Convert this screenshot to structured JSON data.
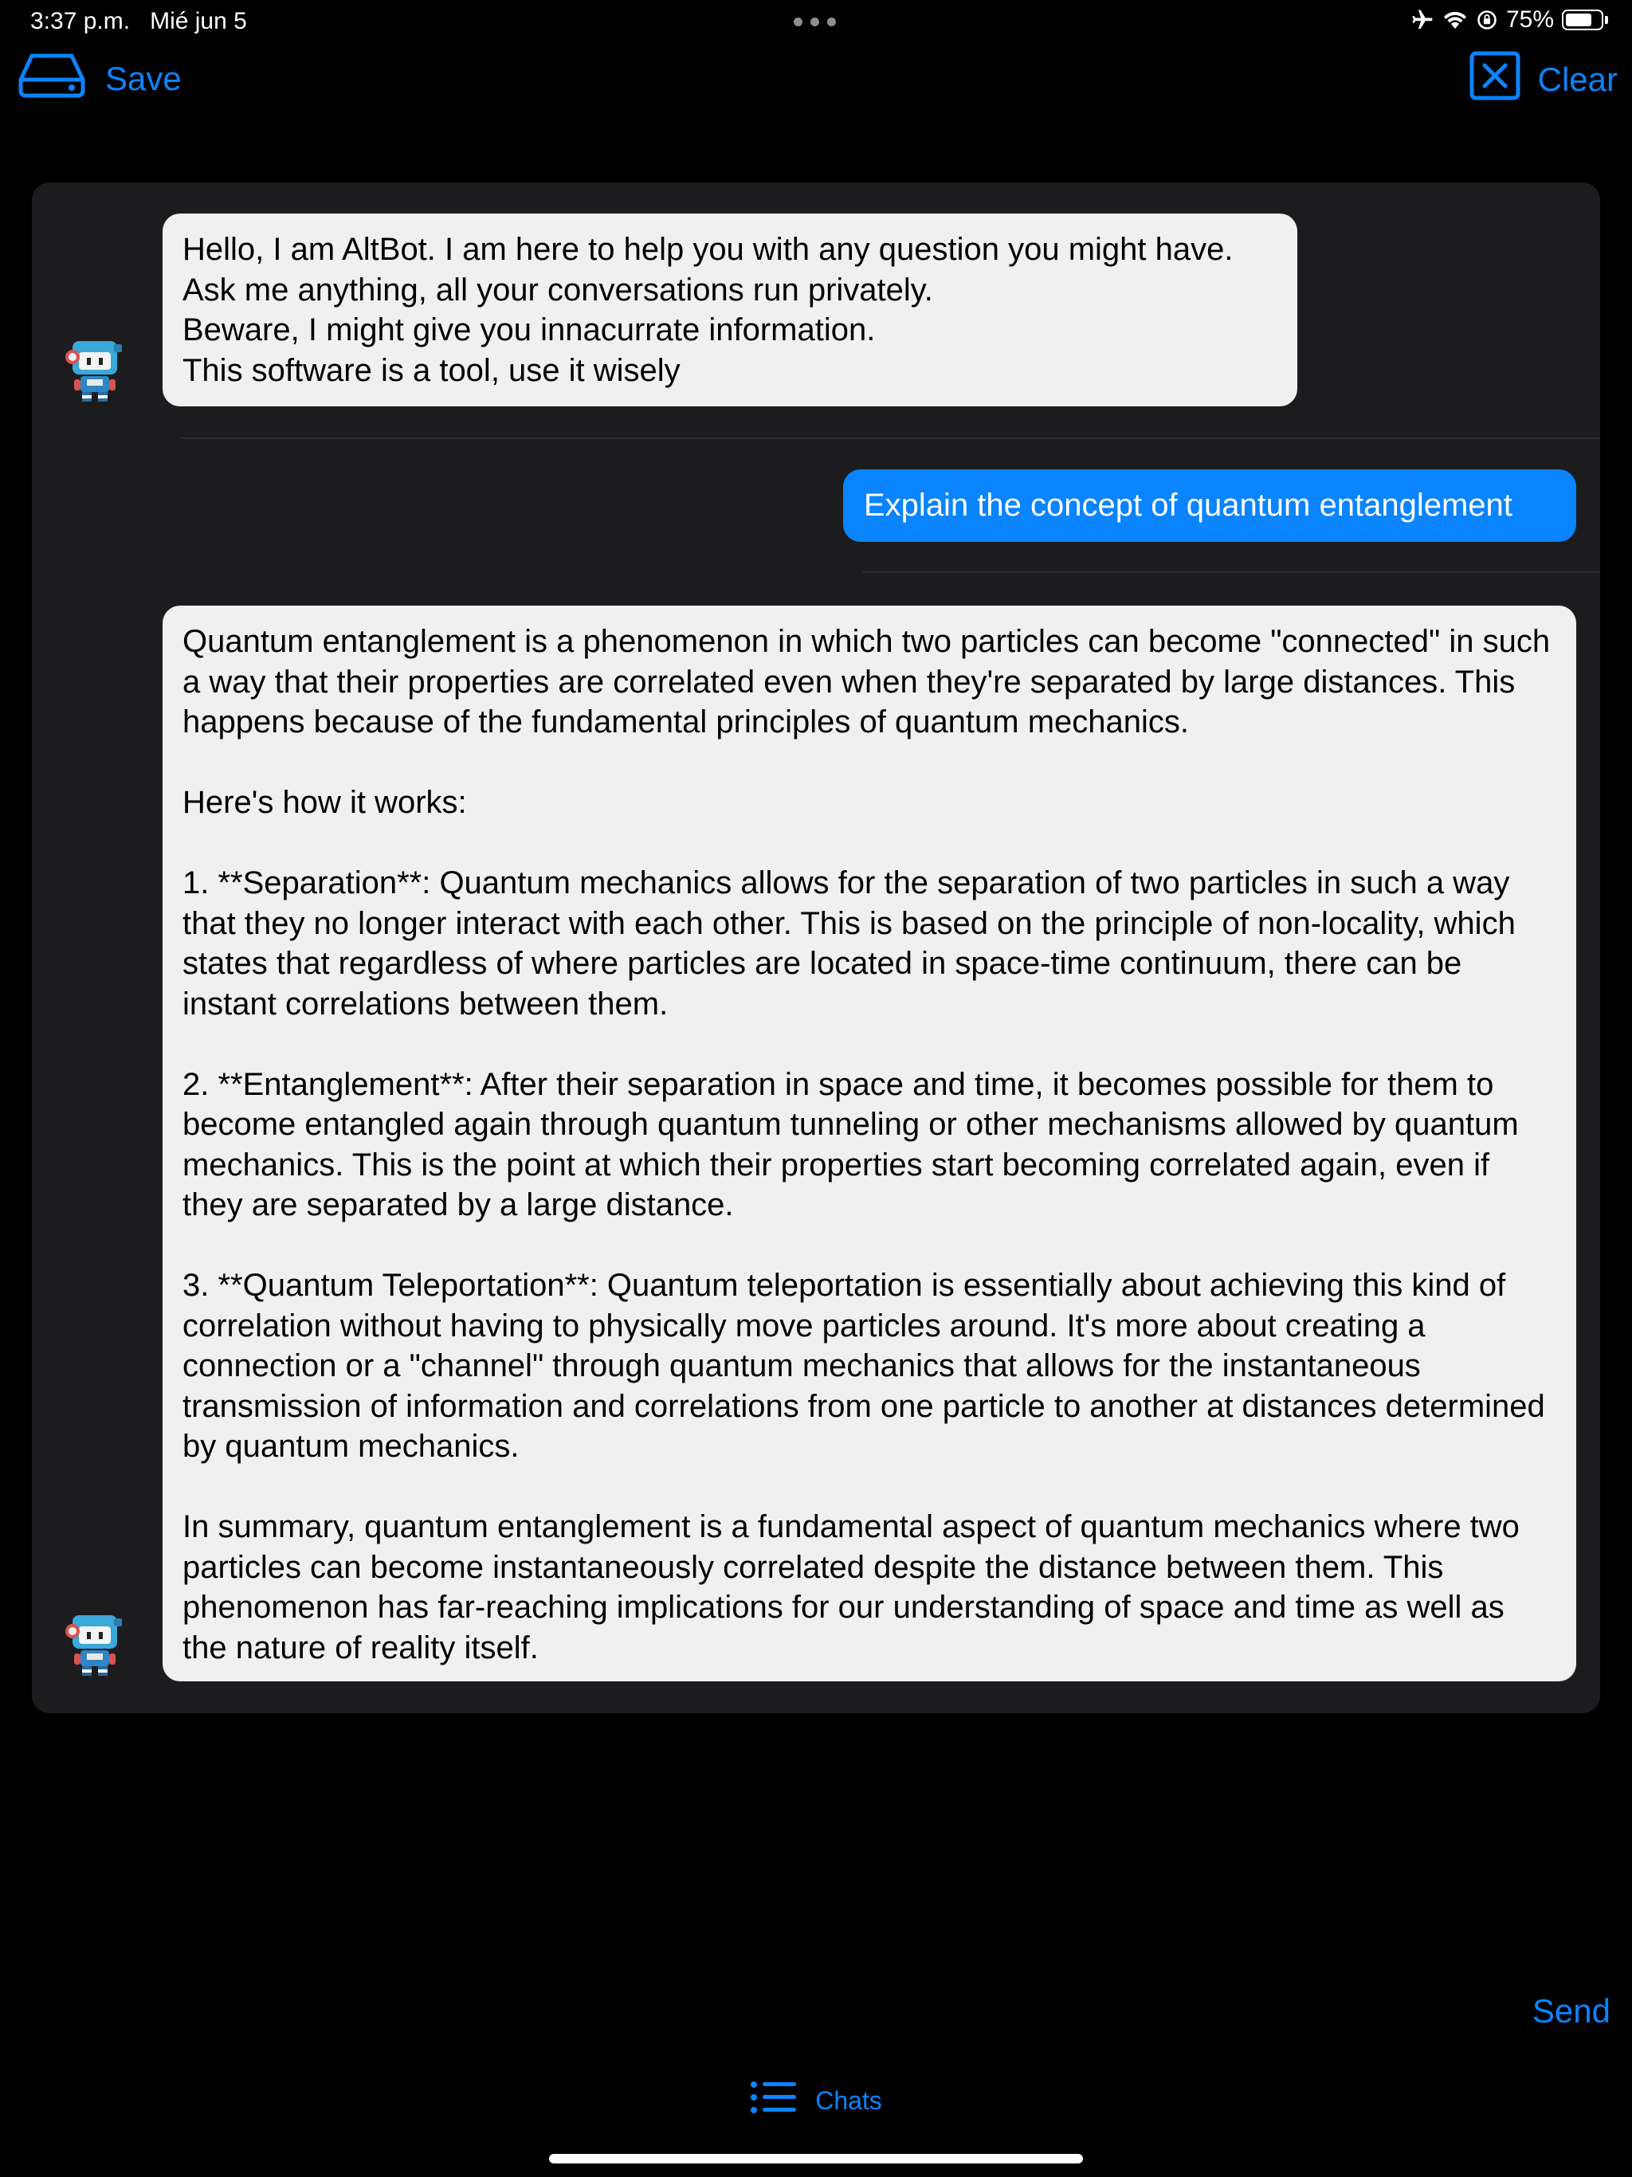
{
  "status_bar": {
    "time": "3:37 p.m.",
    "date": "Mié jun 5",
    "battery_percent": "75%",
    "battery_level": 0.75
  },
  "toolbar": {
    "save_label": "Save",
    "clear_label": "Clear"
  },
  "messages": [
    {
      "role": "bot",
      "text": "Hello, I am AltBot. I am here to help you with any question you might have.\nAsk me anything, all your conversations run privately.\nBeware, I might give you innacurrate information.\nThis software is a tool, use it wisely"
    },
    {
      "role": "user",
      "text": "Explain the concept of quantum entanglement"
    },
    {
      "role": "bot",
      "text": "Quantum entanglement is a phenomenon in which two particles can become \"connected\" in such a way that their properties are correlated even when they're separated by large distances. This happens because of the fundamental principles of quantum mechanics.\n\nHere's how it works:\n\n1. **Separation**: Quantum mechanics allows for the separation of two particles in such a way that they no longer interact with each other. This is based on the principle of non-locality, which states that regardless of where particles are located in space-time continuum, there can be instant correlations between them.\n\n2. **Entanglement**: After their separation in space and time, it becomes possible for them to become entangled again through quantum tunneling or other mechanisms allowed by quantum mechanics. This is the point at which their properties start becoming correlated again, even if they are separated by a large distance.\n\n3. **Quantum Teleportation**: Quantum teleportation is essentially about achieving this kind of correlation without having to physically move particles around. It's more about creating a connection or a \"channel\" through quantum mechanics that allows for the instantaneous transmission of information and correlations from one particle to another at distances determined by quantum mechanics.\n\nIn summary, quantum entanglement is a fundamental aspect of quantum mechanics where two particles can become instantaneously correlated despite the distance between them. This phenomenon has far-reaching implications for our understanding of space and time as well as the nature of reality itself."
    }
  ],
  "composer": {
    "send_label": "Send"
  },
  "tab_bar": {
    "chats_label": "Chats"
  },
  "icons": {
    "save": "drive-icon",
    "clear": "x-square-icon",
    "chats": "list-icon",
    "avatar": "robot-avatar-icon"
  },
  "colors": {
    "accent": "#0a84ff",
    "panel": "#1c1c1e",
    "bot_bubble": "#f0f0f0",
    "background": "#000000"
  }
}
